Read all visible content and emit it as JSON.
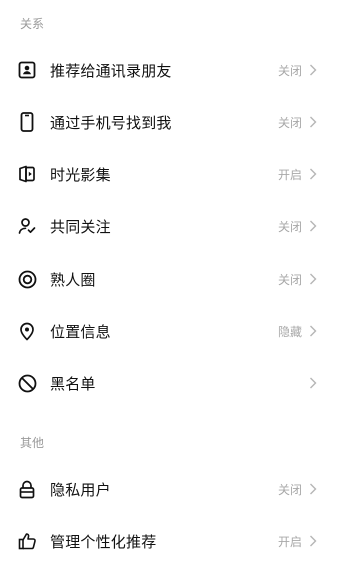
{
  "sections": {
    "relations_label": "关系",
    "other_label": "其他"
  },
  "items": [
    {
      "label": "推荐给通讯录朋友",
      "status": "关闭",
      "icon": "contact-card-icon"
    },
    {
      "label": "通过手机号找到我",
      "status": "关闭",
      "icon": "phone-icon"
    },
    {
      "label": "时光影集",
      "status": "开启",
      "icon": "photo-album-play-icon"
    },
    {
      "label": "共同关注",
      "status": "关闭",
      "icon": "user-check-icon"
    },
    {
      "label": "熟人圈",
      "status": "关闭",
      "icon": "target-circle-icon"
    },
    {
      "label": "位置信息",
      "status": "隐藏",
      "icon": "location-pin-icon"
    },
    {
      "label": "黑名单",
      "status": "",
      "icon": "block-icon"
    },
    {
      "label": "隐私用户",
      "status": "关闭",
      "icon": "lock-icon"
    },
    {
      "label": "管理个性化推荐",
      "status": "开启",
      "icon": "thumbs-up-icon"
    }
  ]
}
